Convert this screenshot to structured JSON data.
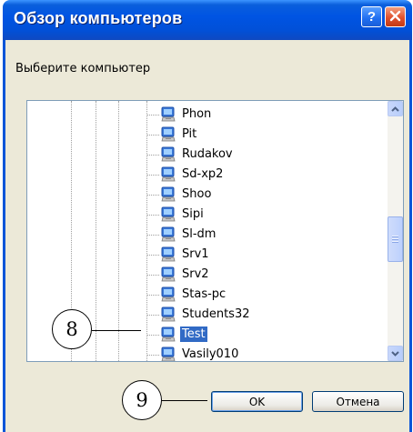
{
  "window": {
    "title": "Обзор компьютеров",
    "help_glyph": "?",
    "close_glyph": "✕"
  },
  "prompt": "Выберите компьютер",
  "tree": {
    "items": [
      {
        "label": "Phon",
        "icon": "computer-icon"
      },
      {
        "label": "Pit",
        "icon": "computer-icon"
      },
      {
        "label": "Rudakov",
        "icon": "computer-icon"
      },
      {
        "label": "Sd-xp2",
        "icon": "computer-icon"
      },
      {
        "label": "Shoo",
        "icon": "computer-icon"
      },
      {
        "label": "Sipi",
        "icon": "computer-icon"
      },
      {
        "label": "Sl-dm",
        "icon": "computer-icon"
      },
      {
        "label": "Srv1",
        "icon": "computer-icon"
      },
      {
        "label": "Srv2",
        "icon": "computer-icon"
      },
      {
        "label": "Stas-pc",
        "icon": "computer-icon"
      },
      {
        "label": "Students32",
        "icon": "computer-icon"
      },
      {
        "label": "Test",
        "icon": "computer-icon",
        "selected": true
      },
      {
        "label": "Vasily010",
        "icon": "computer-icon"
      }
    ],
    "selected": "Test"
  },
  "buttons": {
    "ok_label": "OK",
    "cancel_label": "Отмена"
  },
  "callouts": {
    "c8": "8",
    "c9": "9"
  },
  "colors": {
    "titlebar": "#0054e3",
    "selection": "#316ac5",
    "dialog_bg": "#ece9d8",
    "close_button": "#e0502d"
  }
}
